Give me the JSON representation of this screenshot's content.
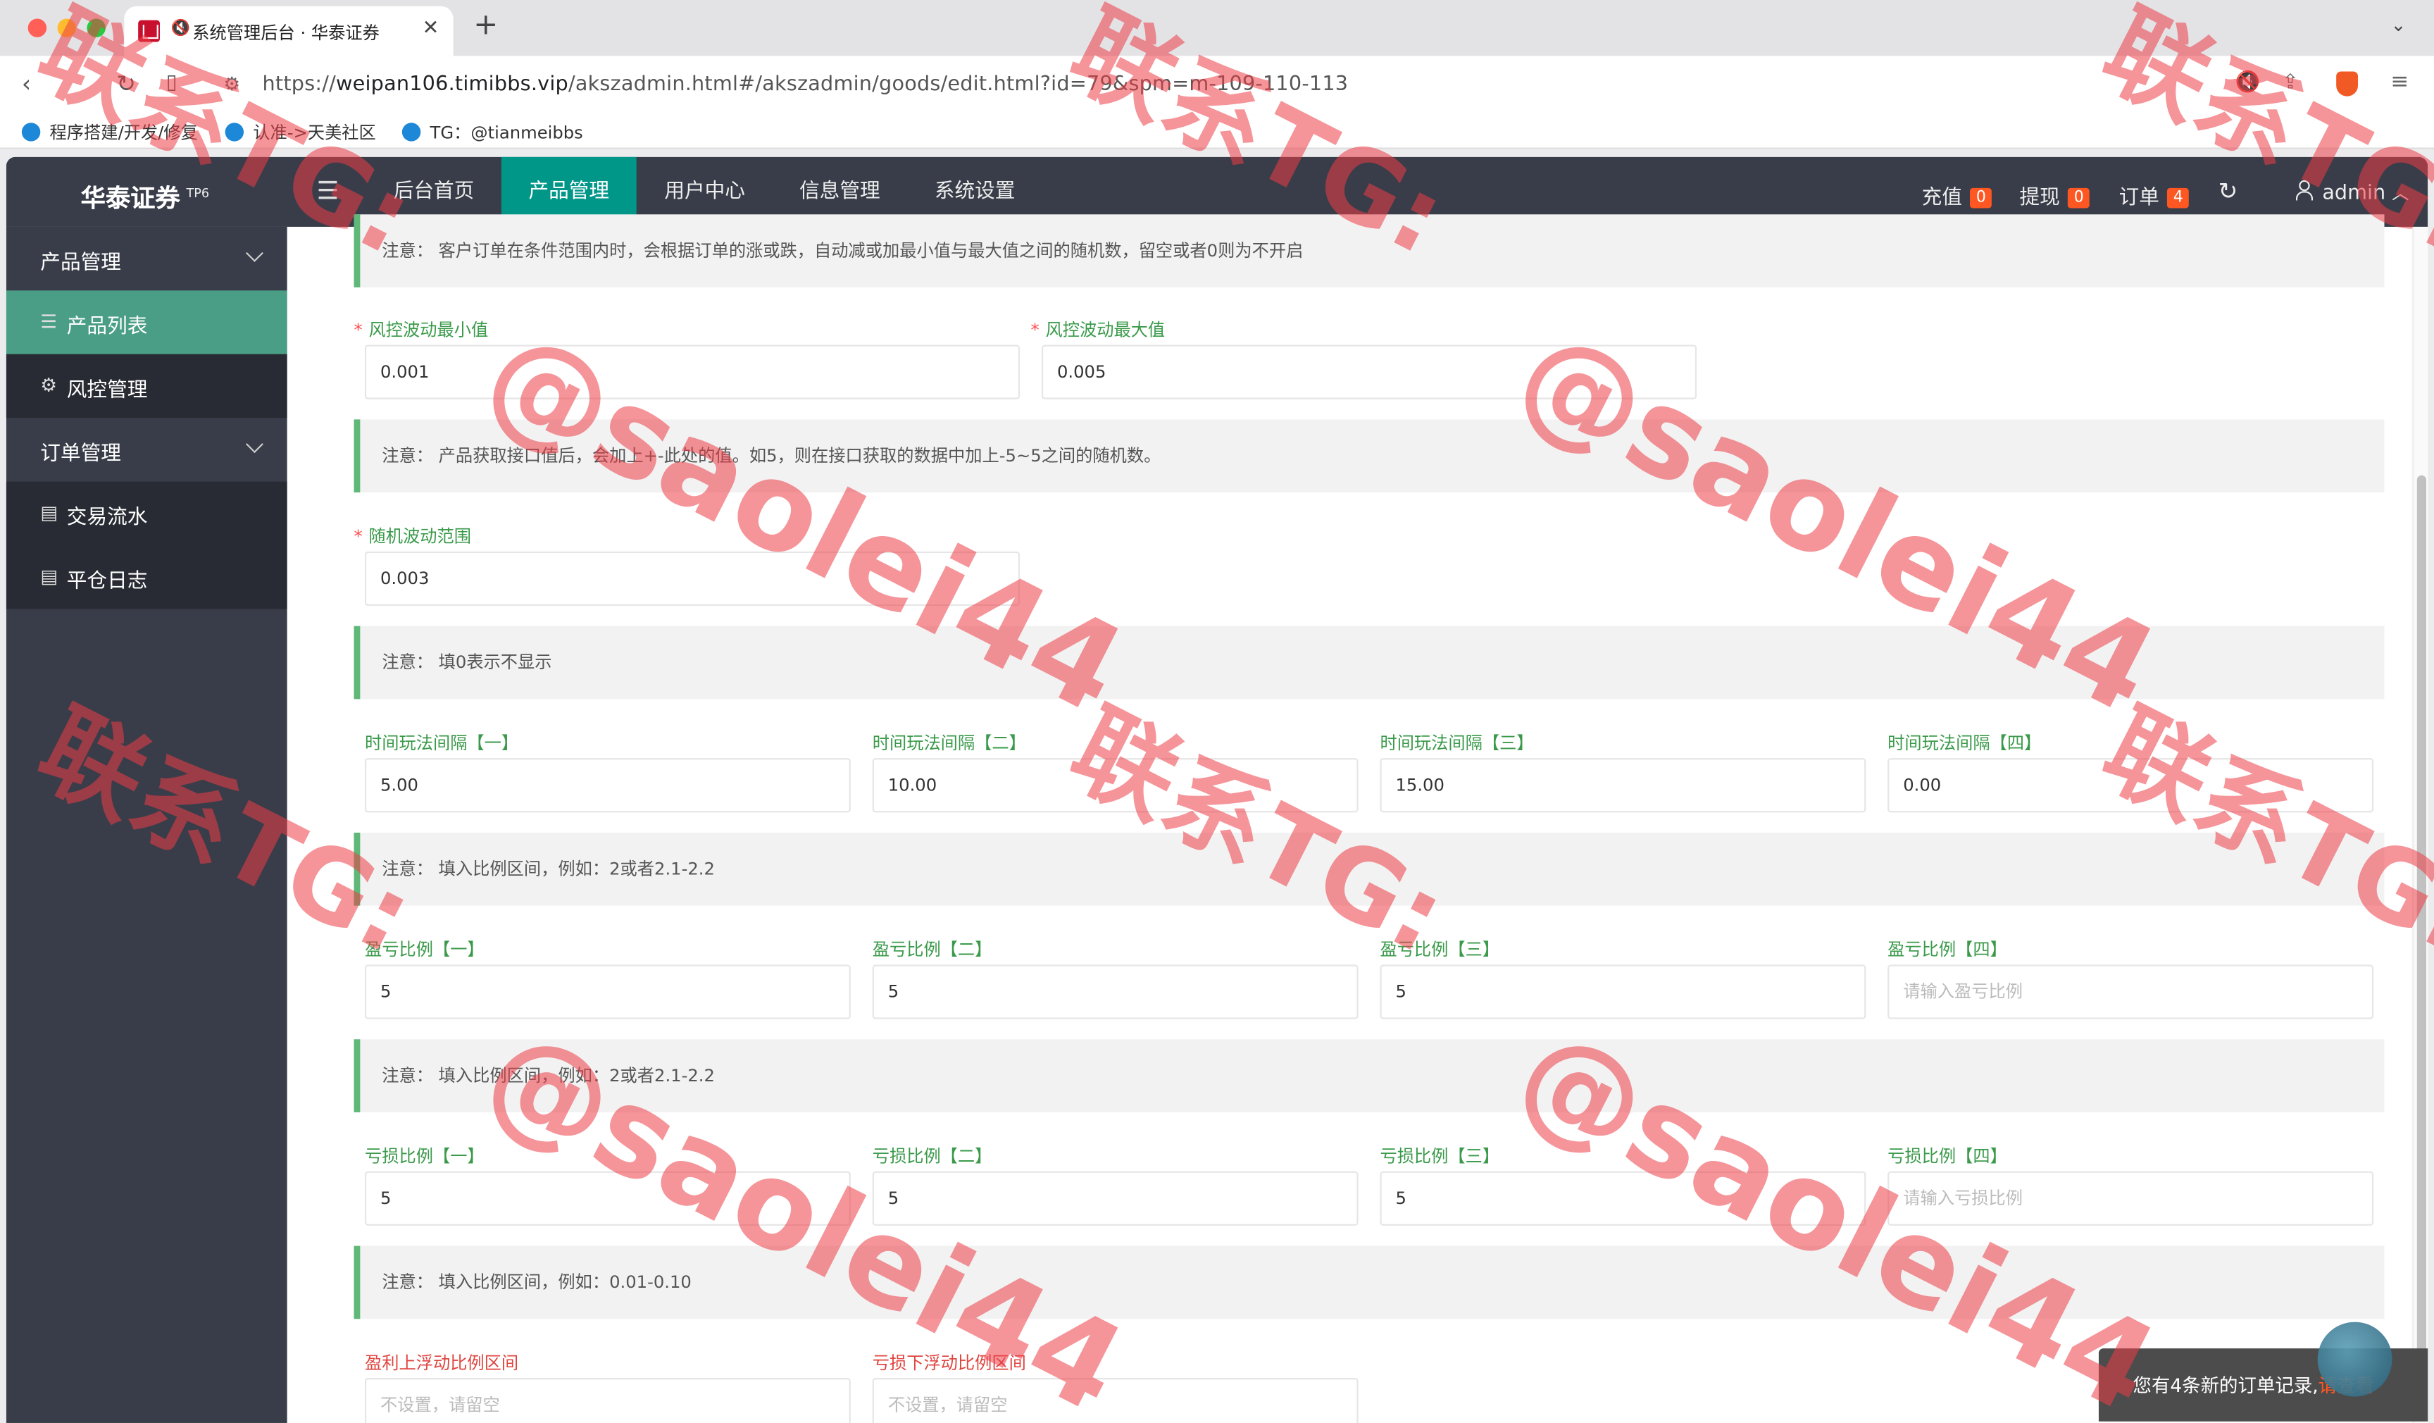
{
  "browser": {
    "tab_title": "系统管理后台 · 华泰证券",
    "url_prefix": "https://",
    "url_host": "weipan106.timibbs.vip",
    "url_path": "/akszadmin.html#/akszadmin/goods/edit.html?id=79&spm=m-109-110-113",
    "bookmarks": [
      "程序搭建/开发/修复",
      "认准->天美社区",
      "TG：@tianmeibbs"
    ]
  },
  "app": {
    "logo": "华泰证券",
    "logo_sup": "TP6",
    "nav": [
      "后台首页",
      "产品管理",
      "用户中心",
      "信息管理",
      "系统设置"
    ],
    "nav_active": "产品管理",
    "topright": {
      "recharge_label": "充值",
      "recharge_count": "0",
      "withdraw_label": "提现",
      "withdraw_count": "0",
      "orders_label": "订单",
      "orders_count": "4",
      "user": "admin"
    }
  },
  "sidebar": {
    "group1": "产品管理",
    "item1": "产品列表",
    "item2": "风控管理",
    "group2": "订单管理",
    "item3": "交易流水",
    "item4": "平仓日志"
  },
  "form": {
    "note1": "注意：  客户订单在条件范围内时，会根据订单的涨或跌，自动减或加最小值与最大值之间的随机数，留空或者0则为不开启",
    "risk_min_label": "风控波动最小值",
    "risk_min_value": "0.001",
    "risk_max_label": "风控波动最大值",
    "risk_max_value": "0.005",
    "note2": "注意：  产品获取接口值后，会加上+-此处的值。如5，则在接口获取的数据中加上-5~5之间的随机数。",
    "random_label": "随机波动范围",
    "random_value": "0.003",
    "note3": "注意：  填0表示不显示",
    "interval_labels": [
      "时间玩法间隔【一】",
      "时间玩法间隔【二】",
      "时间玩法间隔【三】",
      "时间玩法间隔【四】"
    ],
    "interval_values": [
      "5.00",
      "10.00",
      "15.00",
      "0.00"
    ],
    "note4": "注意：  填入比例区间，例如：2或者2.1-2.2",
    "profit_labels": [
      "盈亏比例【一】",
      "盈亏比例【二】",
      "盈亏比例【三】",
      "盈亏比例【四】"
    ],
    "profit_values": [
      "5",
      "5",
      "5",
      ""
    ],
    "profit_placeholder": "请输入盈亏比例",
    "note5": "注意：  填入比例区间，例如：2或者2.1-2.2",
    "loss_labels": [
      "亏损比例【一】",
      "亏损比例【二】",
      "亏损比例【三】",
      "亏损比例【四】"
    ],
    "loss_values": [
      "5",
      "5",
      "5",
      ""
    ],
    "loss_placeholder": "请输入亏损比例",
    "note6": "注意：  填入比例区间，例如：0.01-0.10",
    "float_up_label": "盈利上浮动比例区间",
    "float_down_label": "亏损下浮动比例区间",
    "float_placeholder": "不设置，请留空"
  },
  "toast": {
    "message": "您有4条新的订单记录,",
    "link": "请查看"
  },
  "watermark": {
    "line_a": "联系TG:",
    "line_b": "@saolei44"
  },
  "colors": {
    "nav_bg": "#393d49",
    "accent": "#009688",
    "badge": "#ff5722",
    "note_border": "#5fb878",
    "label_green": "#3a9a4a"
  }
}
